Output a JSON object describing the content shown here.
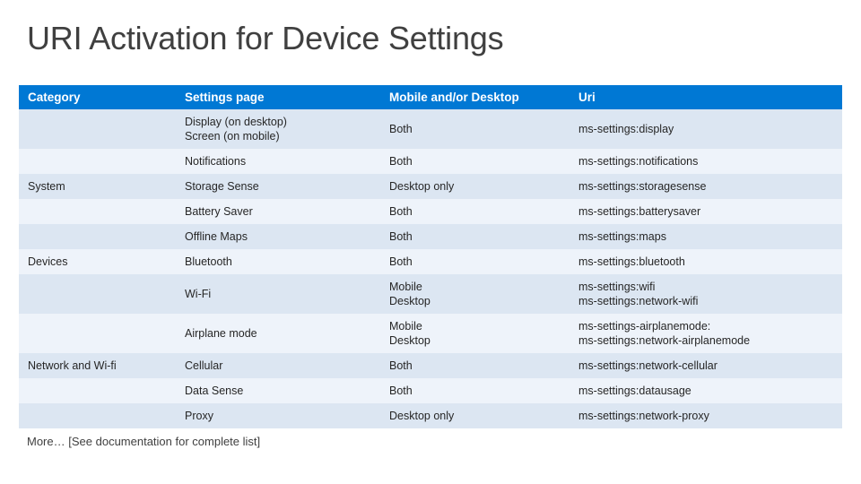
{
  "slide": {
    "title": "URI Activation for Device Settings",
    "footer_more": "More…",
    "footer_bracket": "[See documentation for complete list]"
  },
  "table": {
    "headers": [
      "Category",
      "Settings page",
      "Mobile and/or Desktop",
      "Uri"
    ],
    "rows": [
      {
        "category": "",
        "settings_page": "Display (on desktop)\nScreen (on mobile)",
        "settings_page_lines": [
          "Display (on desktop)",
          "Screen (on mobile)"
        ],
        "platform": "Both",
        "platform_lines": [
          "Both"
        ],
        "uri": "ms-settings:display",
        "uri_lines": [
          "ms-settings:display"
        ]
      },
      {
        "category": "",
        "settings_page": "Notifications",
        "settings_page_lines": [
          "Notifications"
        ],
        "platform": "Both",
        "platform_lines": [
          "Both"
        ],
        "uri": "ms-settings:notifications",
        "uri_lines": [
          "ms-settings:notifications"
        ]
      },
      {
        "category": "System",
        "settings_page": "Storage Sense",
        "settings_page_lines": [
          "Storage Sense"
        ],
        "platform": "Desktop only",
        "platform_lines": [
          "Desktop only"
        ],
        "uri": "ms-settings:storagesense",
        "uri_lines": [
          "ms-settings:storagesense"
        ]
      },
      {
        "category": "",
        "settings_page": "Battery Saver",
        "settings_page_lines": [
          "Battery Saver"
        ],
        "platform": "Both",
        "platform_lines": [
          "Both"
        ],
        "uri": "ms-settings:batterysaver",
        "uri_lines": [
          "ms-settings:batterysaver"
        ]
      },
      {
        "category": "",
        "settings_page": "Offline Maps",
        "settings_page_lines": [
          "Offline Maps"
        ],
        "platform": "Both",
        "platform_lines": [
          "Both"
        ],
        "uri": "ms-settings:maps",
        "uri_lines": [
          "ms-settings:maps"
        ]
      },
      {
        "category": "Devices",
        "settings_page": "Bluetooth",
        "settings_page_lines": [
          "Bluetooth"
        ],
        "platform": "Both",
        "platform_lines": [
          "Both"
        ],
        "uri": "ms-settings:bluetooth",
        "uri_lines": [
          "ms-settings:bluetooth"
        ]
      },
      {
        "category": "",
        "settings_page": "Wi-Fi",
        "settings_page_lines": [
          "Wi-Fi"
        ],
        "platform": "Mobile\nDesktop",
        "platform_lines": [
          "Mobile",
          "Desktop"
        ],
        "uri": "ms-settings:wifi\nms-settings:network-wifi",
        "uri_lines": [
          "ms-settings:wifi",
          "ms-settings:network-wifi"
        ]
      },
      {
        "category": "",
        "settings_page": "Airplane mode",
        "settings_page_lines": [
          "Airplane mode"
        ],
        "platform": "Mobile\nDesktop",
        "platform_lines": [
          "Mobile",
          "Desktop"
        ],
        "uri": "ms-settings-airplanemode:\nms-settings:network-airplanemode",
        "uri_lines": [
          "ms-settings-airplanemode:",
          "ms-settings:network-airplanemode"
        ]
      },
      {
        "category": "Network and Wi-fi",
        "settings_page": "Cellular",
        "settings_page_lines": [
          "Cellular"
        ],
        "platform": "Both",
        "platform_lines": [
          "Both"
        ],
        "uri": "ms-settings:network-cellular",
        "uri_lines": [
          "ms-settings:network-cellular"
        ]
      },
      {
        "category": "",
        "settings_page": "Data Sense",
        "settings_page_lines": [
          "Data Sense"
        ],
        "platform": "Both",
        "platform_lines": [
          "Both"
        ],
        "uri": "ms-settings:datausage",
        "uri_lines": [
          "ms-settings:datausage"
        ]
      },
      {
        "category": "",
        "settings_page": "Proxy",
        "settings_page_lines": [
          "Proxy"
        ],
        "platform": "Desktop only",
        "platform_lines": [
          "Desktop only"
        ],
        "uri": "ms-settings:network-proxy",
        "uri_lines": [
          "ms-settings:network-proxy"
        ]
      }
    ],
    "category_spans": [
      {
        "label": "System",
        "row_index": 2
      },
      {
        "label": "Devices",
        "row_index": 5
      },
      {
        "label": "Network and Wi-fi",
        "row_index": 8
      }
    ]
  },
  "colors": {
    "header_bg": "#0078d4",
    "header_text": "#ffffff",
    "band_a": "#dce6f2",
    "band_b": "#eef3fa",
    "body_text": "#262626",
    "title_text": "#404040"
  }
}
